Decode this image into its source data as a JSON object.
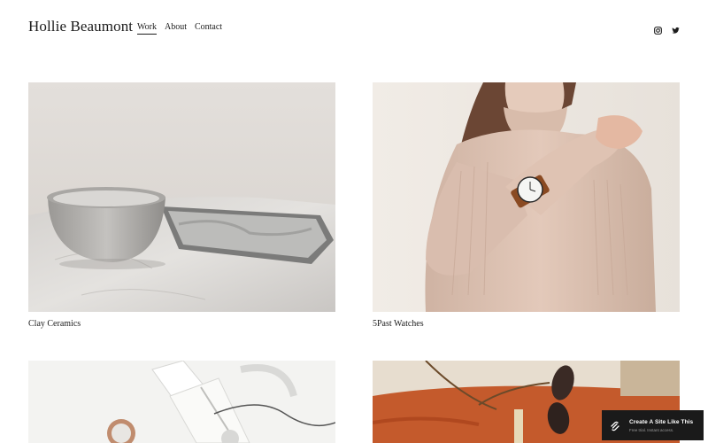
{
  "site": {
    "title": "Hollie Beaumont"
  },
  "nav": [
    {
      "label": "Work",
      "active": true
    },
    {
      "label": "About",
      "active": false
    },
    {
      "label": "Contact",
      "active": false
    }
  ],
  "social": [
    "instagram-icon",
    "twitter-icon"
  ],
  "projects": [
    {
      "title": "Clay Ceramics"
    },
    {
      "title": "5Past Watches"
    },
    {
      "title": ""
    },
    {
      "title": ""
    }
  ],
  "badge": {
    "title": "Create A Site Like This",
    "subtitle": "Free trial. Instant access."
  }
}
